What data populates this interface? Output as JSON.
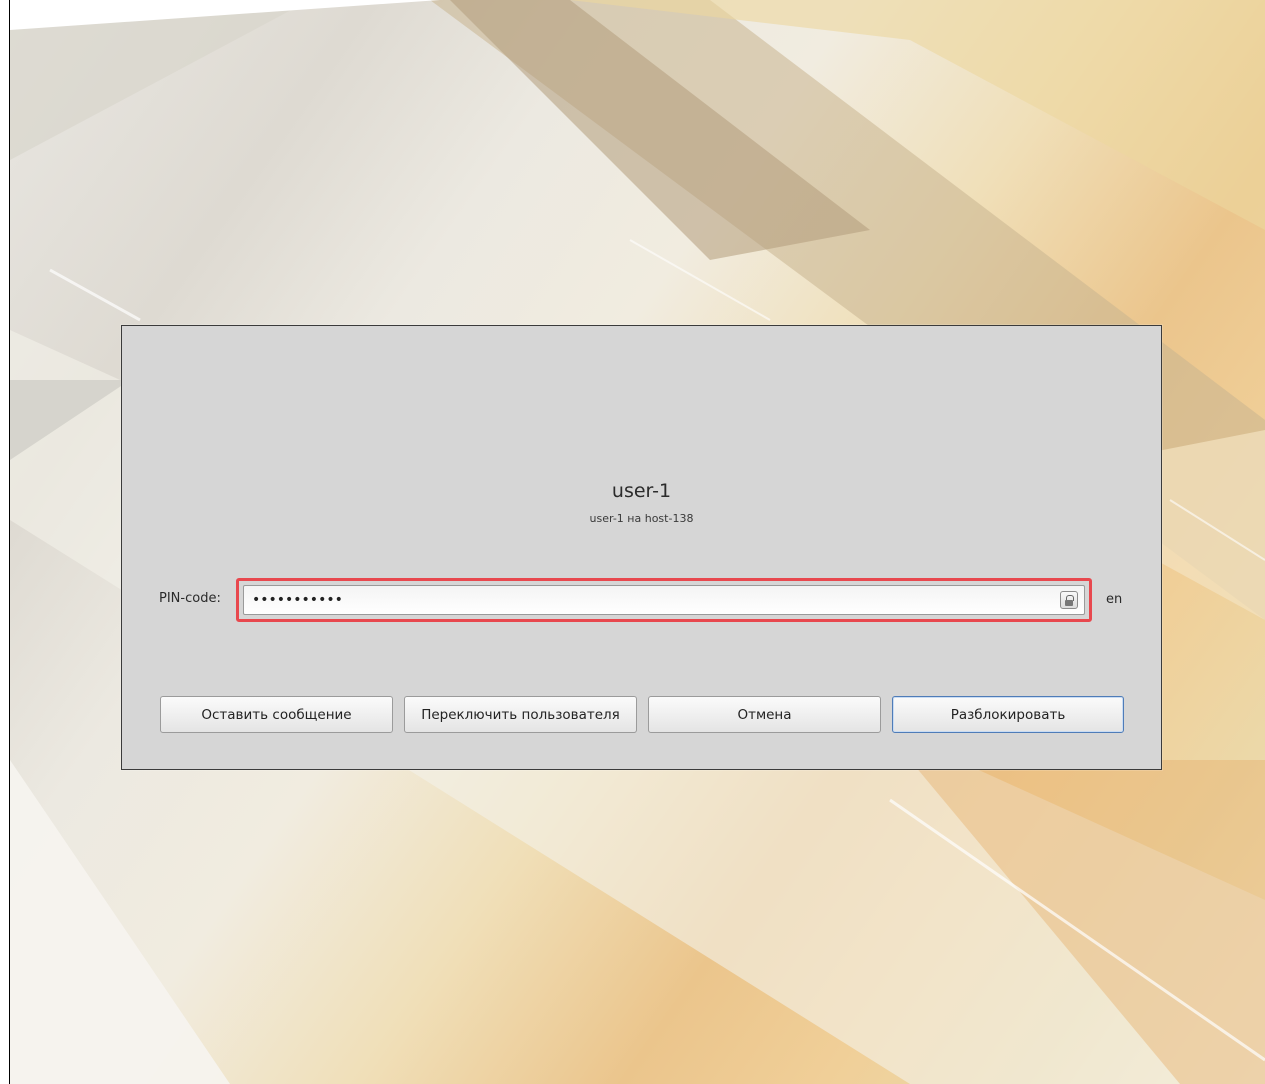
{
  "lock_screen": {
    "user_name": "user-1",
    "user_host": "user-1 на host-138",
    "pin_label": "PIN-code:",
    "pin_value": "•••••••••••",
    "keyboard_layout": "en",
    "buttons": {
      "leave_message": "Оставить сообщение",
      "switch_user": "Переключить пользователя",
      "cancel": "Отмена",
      "unlock": "Разблокировать"
    }
  },
  "colors": {
    "dialog_background": "#d6d6d6",
    "highlight": "#e8484e",
    "primary_button_border": "#4f7cb8"
  }
}
